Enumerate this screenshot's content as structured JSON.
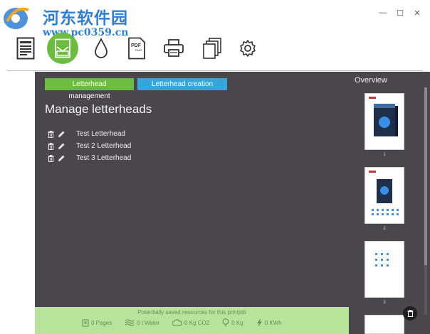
{
  "watermark": {
    "title": "河东软件园",
    "url": "www.pc0359.cn"
  },
  "window": {
    "minimize": "—",
    "maximize": "☐",
    "close": "✕"
  },
  "toolbar": {
    "items": [
      "document-icon",
      "letterhead-icon",
      "drop-icon",
      "pdf-icon",
      "printer-icon",
      "copies-icon",
      "settings-icon"
    ],
    "active": "letterhead-icon",
    "active_color": "#6cbc3f"
  },
  "tabs": {
    "management": "Letterhead management",
    "creation": "Letterhead creation"
  },
  "heading": "Manage letterheads",
  "letterheads": [
    "Test Letterhead",
    "Test 2 Letterhead",
    "Test 3 Letterhead"
  ],
  "savings": {
    "title": "Potentially saved resources for this printjob",
    "items": [
      {
        "icon": "pages-icon",
        "label": "0 Pages"
      },
      {
        "icon": "water-icon",
        "label": "0 l Water"
      },
      {
        "icon": "co2-icon",
        "label": "0 Kg CO2"
      },
      {
        "icon": "tree-icon",
        "label": "0 Kg"
      },
      {
        "icon": "energy-icon",
        "label": "0 KWh"
      }
    ]
  },
  "overview": {
    "title": "Overview",
    "pages": [
      "1",
      "2",
      "3"
    ]
  },
  "colors": {
    "green": "#6cbc3f",
    "blue": "#35a6dc",
    "dark": "#49474c",
    "light_green": "#b7e39a"
  }
}
